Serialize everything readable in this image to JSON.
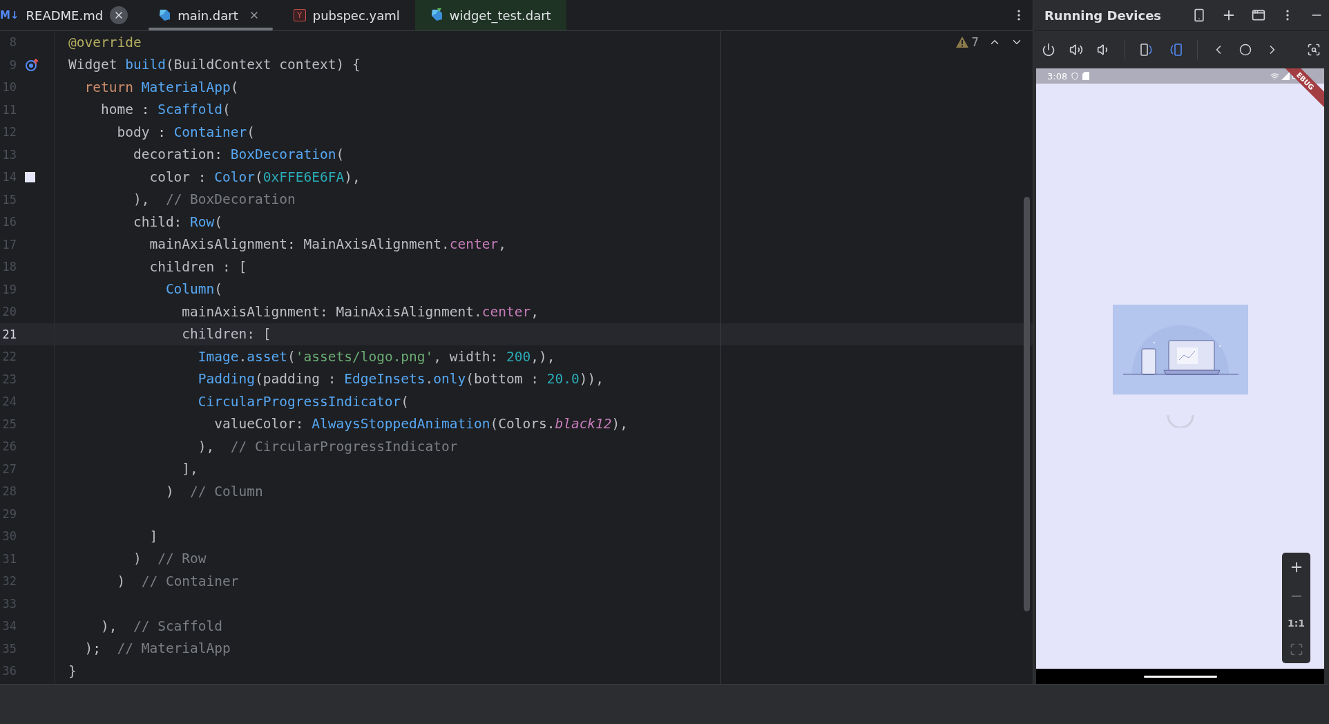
{
  "tabs": [
    {
      "label": "README.md",
      "kind": "markdown",
      "icon_text": "M↓",
      "selected": false,
      "highlighted": false,
      "closable": true
    },
    {
      "label": "main.dart",
      "kind": "dart",
      "selected": true,
      "highlighted": false,
      "closable": true
    },
    {
      "label": "pubspec.yaml",
      "kind": "yaml",
      "icon_text": "Y",
      "selected": false,
      "highlighted": false,
      "closable": false
    },
    {
      "label": "widget_test.dart",
      "kind": "dart-test",
      "selected": false,
      "highlighted": true,
      "closable": false
    }
  ],
  "editor": {
    "warning_count": "7",
    "lines": [
      {
        "number": "8",
        "current": false,
        "segments": [
          {
            "kind": "annotation",
            "text": "@override"
          }
        ]
      },
      {
        "number": "9",
        "current": false,
        "override_marker": true,
        "segments": [
          {
            "kind": "plain",
            "text": "Widget "
          },
          {
            "kind": "type",
            "text": "build"
          },
          {
            "kind": "plain",
            "text": "(BuildContext context) {"
          }
        ]
      },
      {
        "number": "10",
        "current": false,
        "segments": [
          {
            "kind": "keyword",
            "text": "  return "
          },
          {
            "kind": "type",
            "text": "MaterialApp"
          },
          {
            "kind": "plain",
            "text": "("
          }
        ]
      },
      {
        "number": "11",
        "current": false,
        "segments": [
          {
            "kind": "plain",
            "text": "    home : "
          },
          {
            "kind": "type",
            "text": "Scaffold"
          },
          {
            "kind": "plain",
            "text": "("
          }
        ]
      },
      {
        "number": "12",
        "current": false,
        "segments": [
          {
            "kind": "plain",
            "text": "      body : "
          },
          {
            "kind": "type",
            "text": "Container"
          },
          {
            "kind": "plain",
            "text": "("
          }
        ]
      },
      {
        "number": "13",
        "current": false,
        "segments": [
          {
            "kind": "plain",
            "text": "        decoration: "
          },
          {
            "kind": "type",
            "text": "BoxDecoration"
          },
          {
            "kind": "plain",
            "text": "("
          }
        ]
      },
      {
        "number": "14",
        "current": false,
        "color": "#e6e6fa",
        "segments": [
          {
            "kind": "plain",
            "text": "          color : "
          },
          {
            "kind": "type",
            "text": "Color"
          },
          {
            "kind": "plain",
            "text": "("
          },
          {
            "kind": "number",
            "text": "0xFFE6E6FA"
          },
          {
            "kind": "plain",
            "text": "),"
          }
        ]
      },
      {
        "number": "15",
        "current": false,
        "segments": [
          {
            "kind": "plain",
            "text": "        ),  "
          },
          {
            "kind": "comment",
            "text": "// BoxDecoration"
          }
        ]
      },
      {
        "number": "16",
        "current": false,
        "segments": [
          {
            "kind": "plain",
            "text": "        child: "
          },
          {
            "kind": "type",
            "text": "Row"
          },
          {
            "kind": "plain",
            "text": "("
          }
        ]
      },
      {
        "number": "17",
        "current": false,
        "segments": [
          {
            "kind": "plain",
            "text": "          mainAxisAlignment: MainAxisAlignment."
          },
          {
            "kind": "member",
            "text": "center"
          },
          {
            "kind": "plain",
            "text": ","
          }
        ]
      },
      {
        "number": "18",
        "current": false,
        "segments": [
          {
            "kind": "plain",
            "text": "          children : ["
          }
        ]
      },
      {
        "number": "19",
        "current": false,
        "segments": [
          {
            "kind": "type",
            "text": "            Column"
          },
          {
            "kind": "plain",
            "text": "("
          }
        ]
      },
      {
        "number": "20",
        "current": false,
        "segments": [
          {
            "kind": "plain",
            "text": "              mainAxisAlignment: MainAxisAlignment."
          },
          {
            "kind": "member",
            "text": "center"
          },
          {
            "kind": "plain",
            "text": ","
          }
        ]
      },
      {
        "number": "21",
        "current": true,
        "segments": [
          {
            "kind": "plain",
            "text": "              children: ["
          }
        ]
      },
      {
        "number": "22",
        "current": false,
        "segments": [
          {
            "kind": "type",
            "text": "                Image"
          },
          {
            "kind": "plain",
            "text": "."
          },
          {
            "kind": "type",
            "text": "asset"
          },
          {
            "kind": "plain",
            "text": "("
          },
          {
            "kind": "string",
            "text": "'assets/logo.png'"
          },
          {
            "kind": "plain",
            "text": ", width: "
          },
          {
            "kind": "number",
            "text": "200"
          },
          {
            "kind": "plain",
            "text": ",),"
          }
        ]
      },
      {
        "number": "23",
        "current": false,
        "segments": [
          {
            "kind": "type",
            "text": "                Padding"
          },
          {
            "kind": "plain",
            "text": "(padding : "
          },
          {
            "kind": "type",
            "text": "EdgeInsets"
          },
          {
            "kind": "plain",
            "text": "."
          },
          {
            "kind": "type",
            "text": "only"
          },
          {
            "kind": "plain",
            "text": "(bottom : "
          },
          {
            "kind": "number",
            "text": "20.0"
          },
          {
            "kind": "plain",
            "text": ")),"
          }
        ]
      },
      {
        "number": "24",
        "current": false,
        "segments": [
          {
            "kind": "type",
            "text": "                CircularProgressIndicator"
          },
          {
            "kind": "plain",
            "text": "("
          }
        ]
      },
      {
        "number": "25",
        "current": false,
        "segments": [
          {
            "kind": "plain",
            "text": "                  valueColor: "
          },
          {
            "kind": "type",
            "text": "AlwaysStoppedAnimation"
          },
          {
            "kind": "plain",
            "text": "(Colors."
          },
          {
            "kind": "member-italic",
            "text": "black12"
          },
          {
            "kind": "plain",
            "text": "),"
          }
        ]
      },
      {
        "number": "26",
        "current": false,
        "segments": [
          {
            "kind": "plain",
            "text": "                ),  "
          },
          {
            "kind": "comment",
            "text": "// CircularProgressIndicator"
          }
        ]
      },
      {
        "number": "27",
        "current": false,
        "segments": [
          {
            "kind": "plain",
            "text": "              ],"
          }
        ]
      },
      {
        "number": "28",
        "current": false,
        "segments": [
          {
            "kind": "plain",
            "text": "            )  "
          },
          {
            "kind": "comment",
            "text": "// Column"
          }
        ]
      },
      {
        "number": "29",
        "current": false
      },
      {
        "number": "30",
        "current": false,
        "segments": [
          {
            "kind": "plain",
            "text": "          ]"
          }
        ]
      },
      {
        "number": "31",
        "current": false,
        "segments": [
          {
            "kind": "plain",
            "text": "        )  "
          },
          {
            "kind": "comment",
            "text": "// Row"
          }
        ]
      },
      {
        "number": "32",
        "current": false,
        "segments": [
          {
            "kind": "plain",
            "text": "      )  "
          },
          {
            "kind": "comment",
            "text": "// Container"
          }
        ]
      },
      {
        "number": "33",
        "current": false
      },
      {
        "number": "34",
        "current": false,
        "segments": [
          {
            "kind": "plain",
            "text": "    ),  "
          },
          {
            "kind": "comment",
            "text": "// Scaffold"
          }
        ]
      },
      {
        "number": "35",
        "current": false,
        "segments": [
          {
            "kind": "plain",
            "text": "  );  "
          },
          {
            "kind": "comment",
            "text": "// MaterialApp"
          }
        ]
      },
      {
        "number": "36",
        "current": false,
        "segments": [
          {
            "kind": "plain",
            "text": "}"
          }
        ]
      }
    ]
  },
  "running_devices": {
    "title": "Running Devices",
    "phone": {
      "time": "3:08",
      "banner": "EBUG",
      "zoom_label": "1:1"
    }
  }
}
